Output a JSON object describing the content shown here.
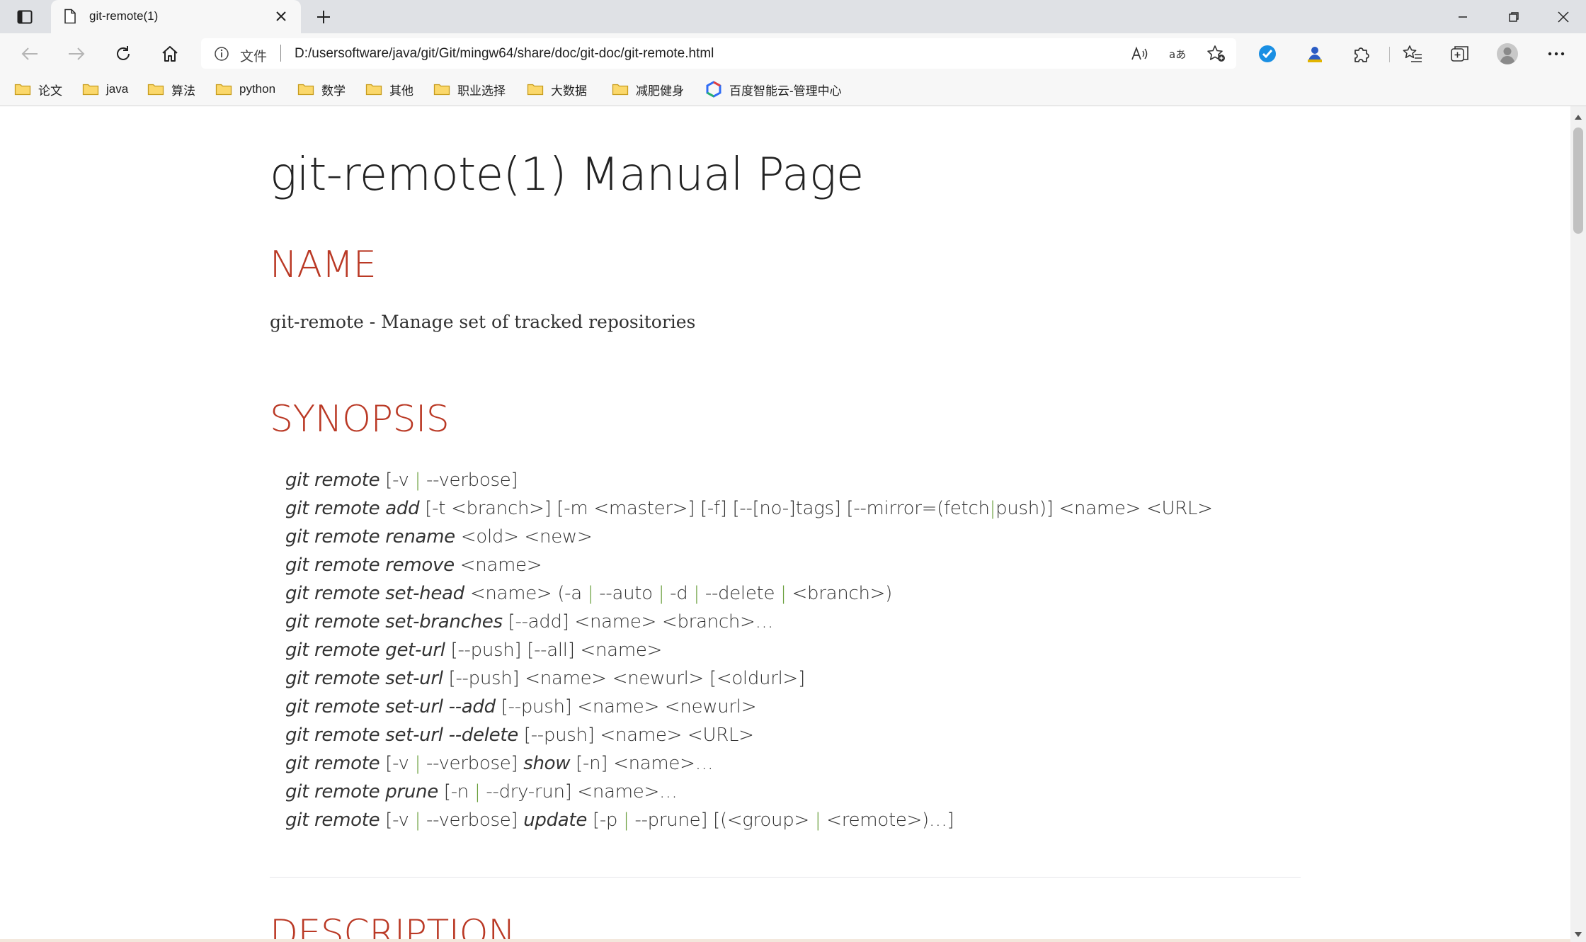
{
  "tab": {
    "title": "git-remote(1)"
  },
  "toolbar": {
    "scheme_label": "文件",
    "url": "D:/usersoftware/java/git/Git/mingw64/share/doc/git-doc/git-remote.html"
  },
  "bookmarks": [
    {
      "label": "论文",
      "icon": "folder-icon"
    },
    {
      "label": "java",
      "icon": "folder-icon"
    },
    {
      "label": "算法",
      "icon": "folder-icon"
    },
    {
      "label": "python",
      "icon": "folder-icon"
    },
    {
      "label": "数学",
      "icon": "folder-icon"
    },
    {
      "label": "其他",
      "icon": "folder-icon"
    },
    {
      "label": "职业选择",
      "icon": "folder-icon"
    },
    {
      "label": "大数据",
      "icon": "folder-icon"
    },
    {
      "label": "减肥健身",
      "icon": "folder-icon"
    },
    {
      "label": "百度智能云-管理中心",
      "icon": "baidu-cloud-icon"
    }
  ],
  "page": {
    "title": "git-remote(1) Manual Page",
    "name_heading": "NAME",
    "name_text": "git-remote - Manage set of tracked repositories",
    "synopsis_heading": "SYNOPSIS",
    "synopsis_lines": [
      [
        [
          "i",
          "git remote"
        ],
        [
          "t",
          " [-v "
        ],
        [
          "b",
          "|"
        ],
        [
          "t",
          " --verbose]"
        ]
      ],
      [
        [
          "i",
          "git remote add"
        ],
        [
          "t",
          " [-t <branch>] [-m <master>] [-f] [--[no-]tags] [--mirror=(fetch"
        ],
        [
          "b",
          "|"
        ],
        [
          "t",
          "push)] <name> <URL>"
        ]
      ],
      [
        [
          "i",
          "git remote rename"
        ],
        [
          "t",
          " <old> <new>"
        ]
      ],
      [
        [
          "i",
          "git remote remove"
        ],
        [
          "t",
          " <name>"
        ]
      ],
      [
        [
          "i",
          "git remote set-head"
        ],
        [
          "t",
          " <name> (-a "
        ],
        [
          "b",
          "|"
        ],
        [
          "t",
          " --auto "
        ],
        [
          "b",
          "|"
        ],
        [
          "t",
          " -d "
        ],
        [
          "b",
          "|"
        ],
        [
          "t",
          " --delete "
        ],
        [
          "b",
          "|"
        ],
        [
          "t",
          " <branch>)"
        ]
      ],
      [
        [
          "i",
          "git remote set-branches"
        ],
        [
          "t",
          " [--add] <name> <branch>…"
        ]
      ],
      [
        [
          "i",
          "git remote get-url"
        ],
        [
          "t",
          " [--push] [--all] <name>"
        ]
      ],
      [
        [
          "i",
          "git remote set-url"
        ],
        [
          "t",
          " [--push] <name> <newurl> [<oldurl>]"
        ]
      ],
      [
        [
          "i",
          "git remote set-url --add"
        ],
        [
          "t",
          " [--push] <name> <newurl>"
        ]
      ],
      [
        [
          "i",
          "git remote set-url --delete"
        ],
        [
          "t",
          " [--push] <name> <URL>"
        ]
      ],
      [
        [
          "i",
          "git remote"
        ],
        [
          "t",
          " [-v "
        ],
        [
          "b",
          "|"
        ],
        [
          "t",
          " --verbose] "
        ],
        [
          "i",
          "show"
        ],
        [
          "t",
          " [-n] <name>…"
        ]
      ],
      [
        [
          "i",
          "git remote prune"
        ],
        [
          "t",
          " [-n "
        ],
        [
          "b",
          "|"
        ],
        [
          "t",
          " --dry-run] <name>…"
        ]
      ],
      [
        [
          "i",
          "git remote"
        ],
        [
          "t",
          " [-v "
        ],
        [
          "b",
          "|"
        ],
        [
          "t",
          " --verbose] "
        ],
        [
          "i",
          "update"
        ],
        [
          "t",
          " [-p "
        ],
        [
          "b",
          "|"
        ],
        [
          "t",
          " --prune] [(<group> "
        ],
        [
          "b",
          "|"
        ],
        [
          "t",
          " <remote>)…]"
        ]
      ]
    ],
    "description_heading": "DESCRIPTION"
  },
  "colors": {
    "heading": "#ba3925",
    "pipe": "#6a9f3d",
    "text": "#333333"
  }
}
